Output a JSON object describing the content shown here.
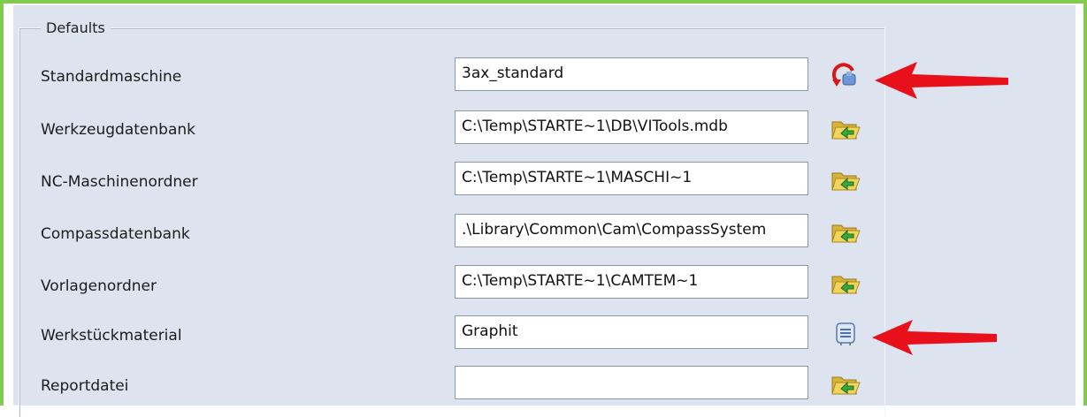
{
  "groupbox": {
    "caption": "Defaults"
  },
  "rows": [
    {
      "label": "Standardmaschine",
      "value": "3ax_standard",
      "icon": "machine-select-icon"
    },
    {
      "label": "Werkzeugdatenbank",
      "value": "C:\\Temp\\STARTE~1\\DB\\VITools.mdb",
      "icon": "folder-open-icon"
    },
    {
      "label": "NC-Maschinenordner",
      "value": "C:\\Temp\\STARTE~1\\MASCHI~1",
      "icon": "folder-open-icon"
    },
    {
      "label": "Compassdatenbank",
      "value": ".\\Library\\Common\\Cam\\CompassSystem",
      "icon": "folder-open-icon"
    },
    {
      "label": "Vorlagenordner",
      "value": "C:\\Temp\\STARTE~1\\CAMTEM~1",
      "icon": "folder-open-icon"
    },
    {
      "label": "Werkstückmaterial",
      "value": "Graphit",
      "icon": "list-icon"
    },
    {
      "label": "Reportdatei",
      "value": "",
      "icon": "folder-open-icon"
    }
  ],
  "annotations": {
    "arrow_color": "#e8101a",
    "frame_color": "#7fcc4e"
  }
}
